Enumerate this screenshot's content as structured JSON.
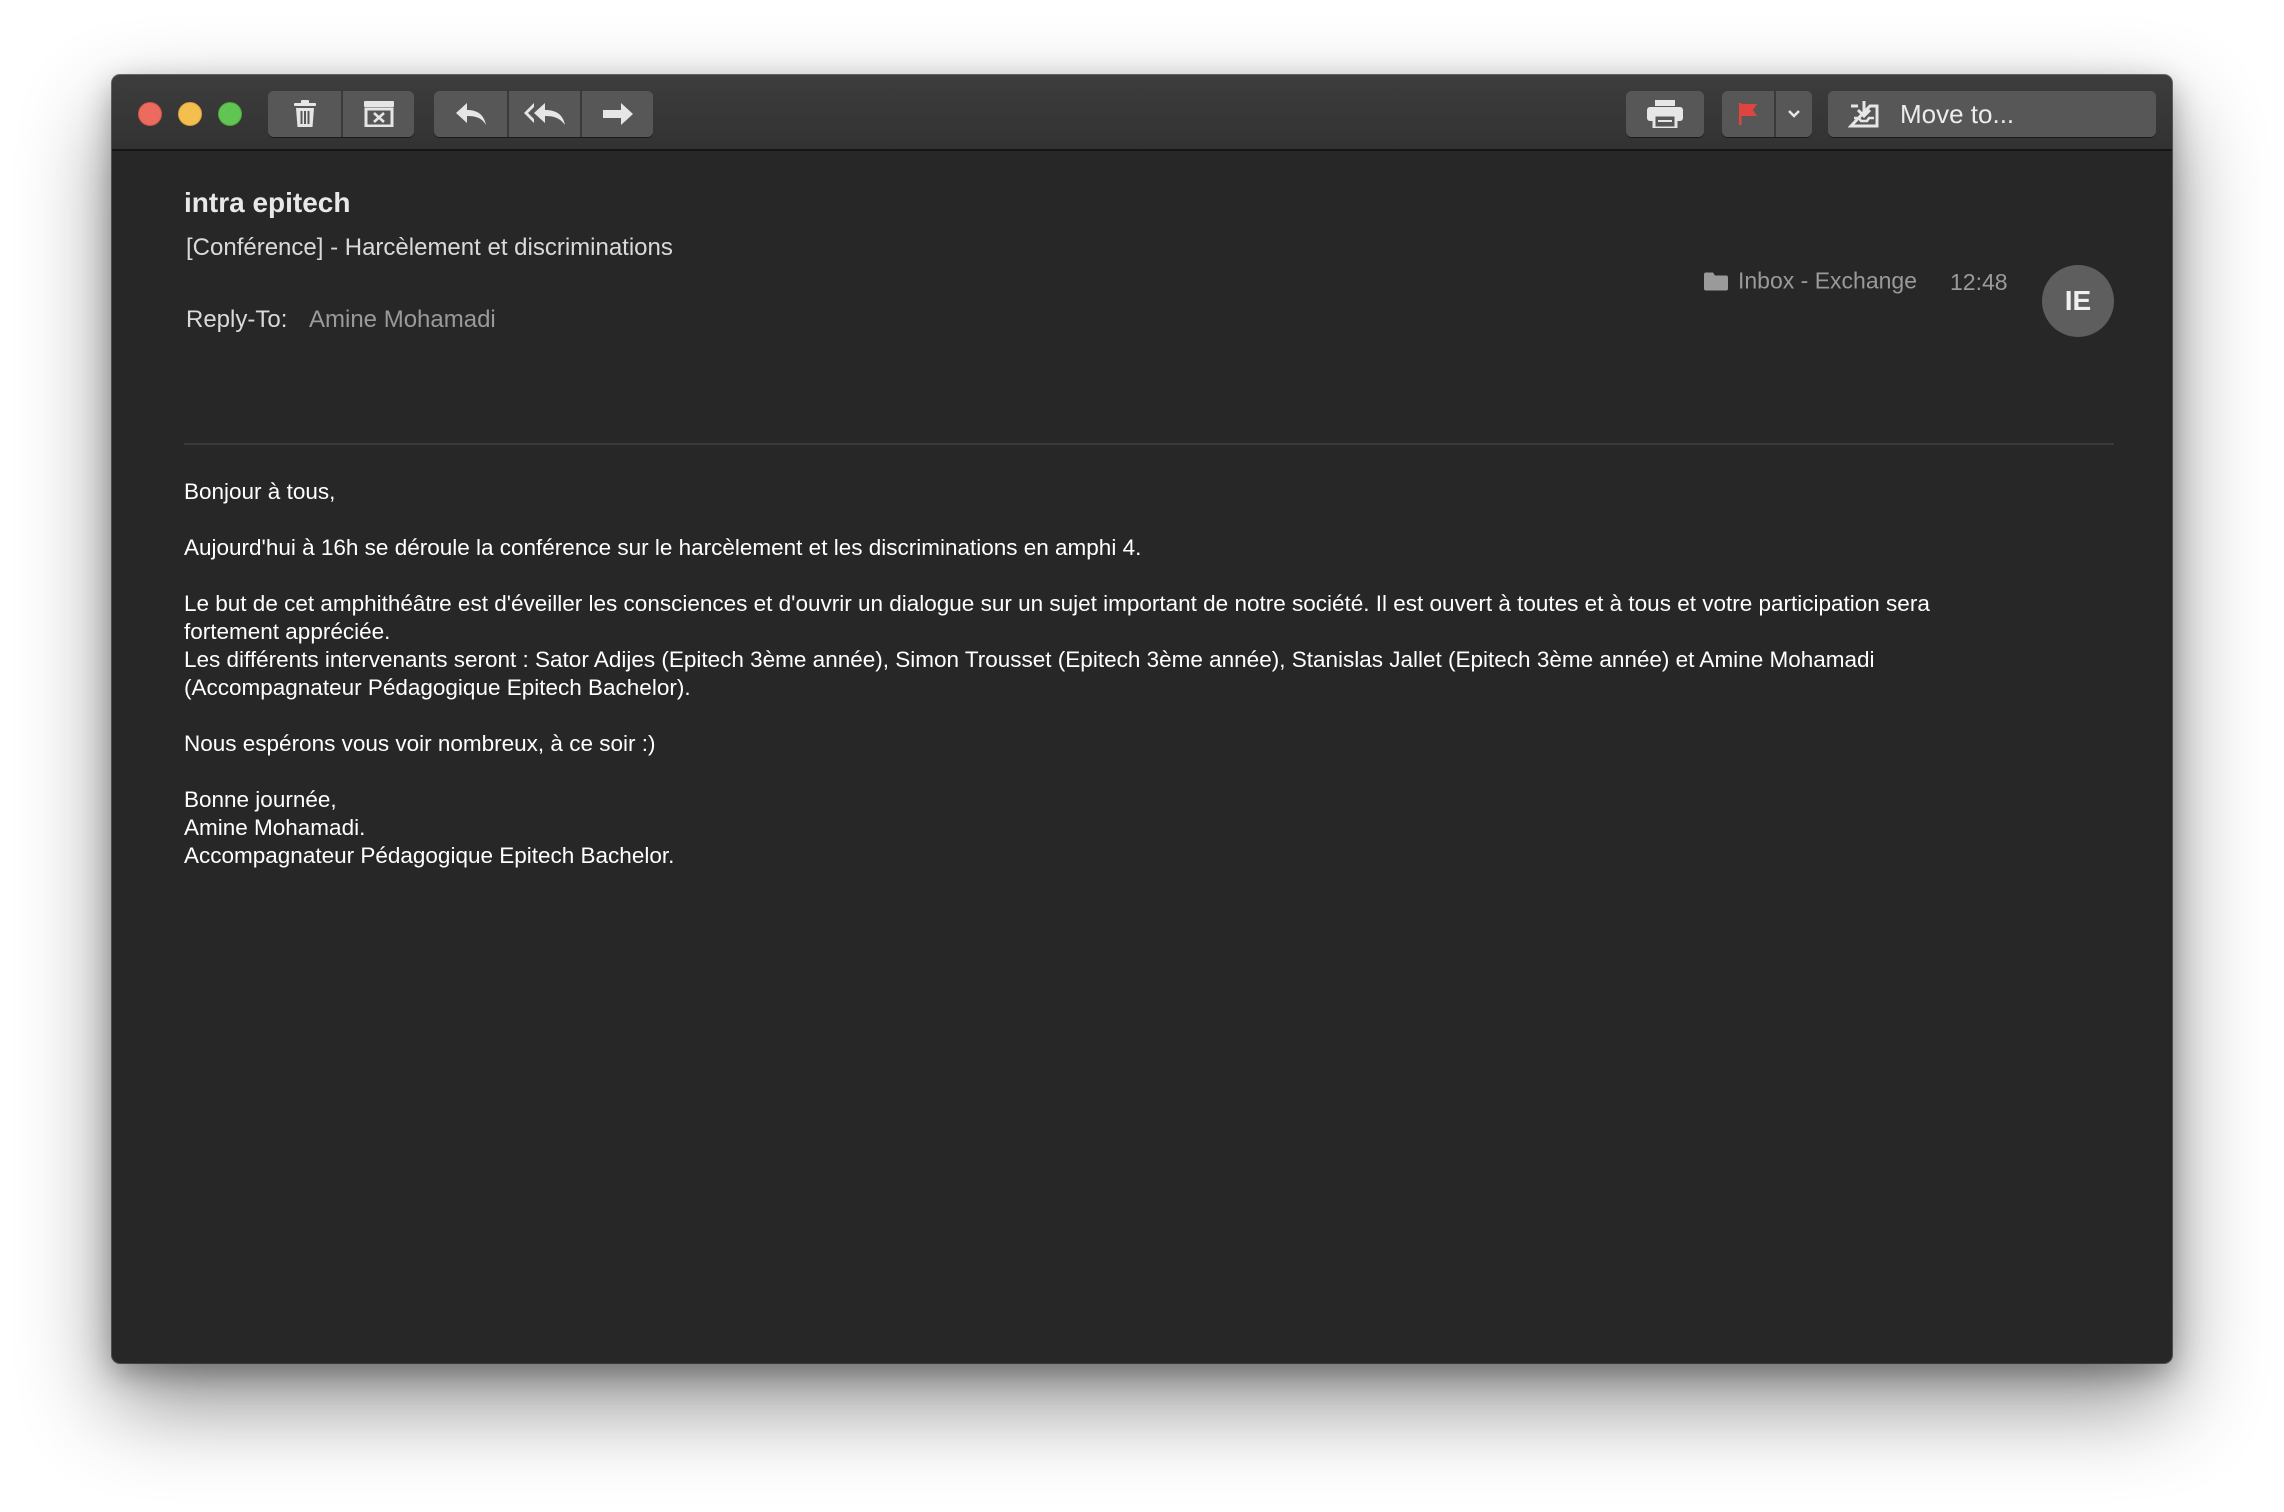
{
  "toolbar": {
    "delete_icon": "trash-icon",
    "archive_icon": "archive-box-icon",
    "reply_icon": "reply-arrow-icon",
    "reply_all_icon": "reply-all-arrow-icon",
    "forward_icon": "forward-arrow-icon",
    "print_icon": "printer-icon",
    "flag_icon": "flag-icon",
    "flag_color": "#e0443e",
    "move_icon": "move-to-tray-icon",
    "move_label": "Move to..."
  },
  "message": {
    "sender": "intra epitech",
    "subject": "[Conférence] - Harcèlement et discriminations",
    "reply_to_label": "Reply-To:",
    "reply_to_value": "Amine Mohamadi",
    "mailbox": "Inbox - Exchange",
    "time": "12:48",
    "avatar_initials": "IE"
  },
  "body": {
    "greeting": "Bonjour à tous,",
    "p1": "Aujourd'hui à 16h se déroule la conférence sur le harcèlement et les discriminations en amphi 4.",
    "p2_line1": "Le but de cet amphithéâtre est d'éveiller les consciences et d'ouvrir un dialogue sur un sujet important de notre société. Il est ouvert à toutes et à tous et votre participation sera",
    "p2_line2": "fortement appréciée.",
    "p2_line3": "Les différents intervenants seront : Sator Adijes (Epitech 3ème année), Simon Trousset (Epitech 3ème année), Stanislas Jallet (Epitech 3ème année) et Amine Mohamadi",
    "p2_line4": "(Accompagnateur Pédagogique Epitech Bachelor).",
    "p3": "Nous espérons vous voir nombreux, à ce soir :)",
    "sign1": "Bonne journée,",
    "sign2": "Amine Mohamadi.",
    "sign3": "Accompagnateur Pédagogique Epitech Bachelor."
  }
}
